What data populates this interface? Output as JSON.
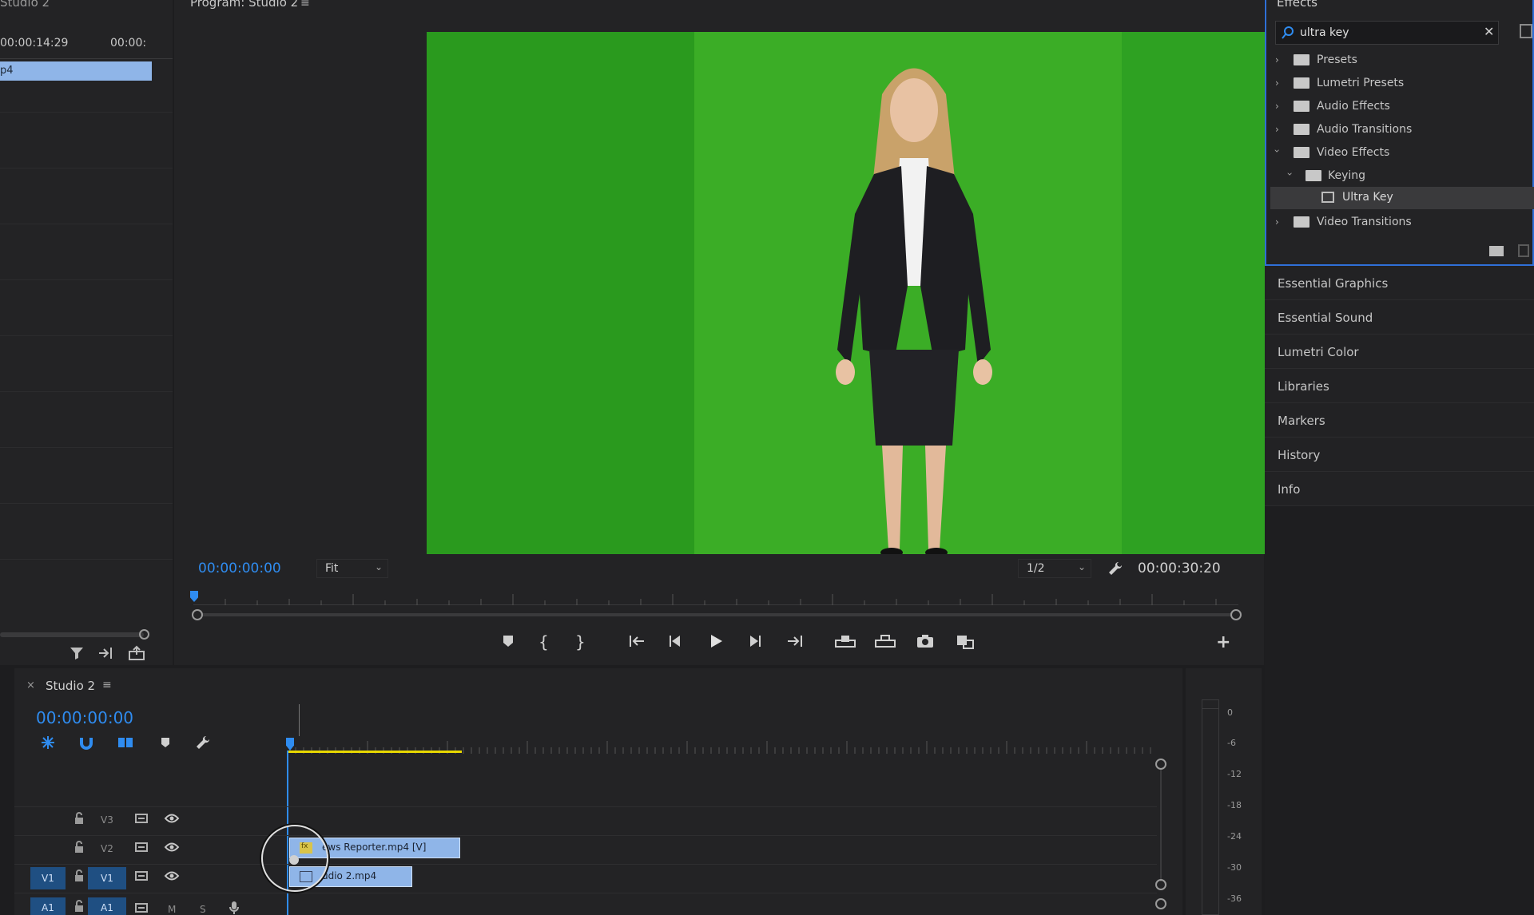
{
  "source": {
    "title": "Studio 2",
    "ruler_time": "00:00:14:29",
    "ruler_time_2": "00:00:",
    "clip_label": "p4"
  },
  "program": {
    "title": "Program: Studio 2",
    "timecode_current": "00:00:00:00",
    "zoom_select": "Fit",
    "resolution_select": "1/2",
    "timecode_duration": "00:00:30:20"
  },
  "effects": {
    "title": "Effects",
    "search_value": "ultra key",
    "tree": [
      {
        "label": "Presets",
        "expanded": false,
        "level": 0
      },
      {
        "label": "Lumetri Presets",
        "expanded": false,
        "level": 0
      },
      {
        "label": "Audio Effects",
        "expanded": false,
        "level": 0
      },
      {
        "label": "Audio Transitions",
        "expanded": false,
        "level": 0
      },
      {
        "label": "Video Effects",
        "expanded": true,
        "level": 0
      },
      {
        "label": "Keying",
        "expanded": true,
        "level": 1
      },
      {
        "label": "Ultra Key",
        "level": 2,
        "selected": true
      },
      {
        "label": "Video Transitions",
        "expanded": false,
        "level": 0
      }
    ]
  },
  "side_panels": [
    "Essential Graphics",
    "Essential Sound",
    "Lumetri Color",
    "Libraries",
    "Markers",
    "History",
    "Info"
  ],
  "timeline": {
    "title": "Studio 2",
    "timecode": "00:00:00:00",
    "tracks": {
      "v3": "V3",
      "v2": "V2",
      "v1_target": "V1",
      "v1": "V1",
      "a1_target": "A1",
      "a1": "A1",
      "mute": "M",
      "solo": "S"
    },
    "clips": {
      "v2_clip": "ews Reporter.mp4 [V]",
      "v1_clip": "udio 2.mp4"
    }
  },
  "audio_meter": {
    "scale": [
      "0",
      "-6",
      "-12",
      "-18",
      "-24",
      "-30",
      "-36"
    ]
  },
  "colors": {
    "accent_blue": "#2f8cf0",
    "panel_focus_border": "#2f6fd8",
    "green_screen": "#2ea122",
    "clip_blue": "#8fb5e8",
    "work_area_yellow": "#e8d800"
  }
}
